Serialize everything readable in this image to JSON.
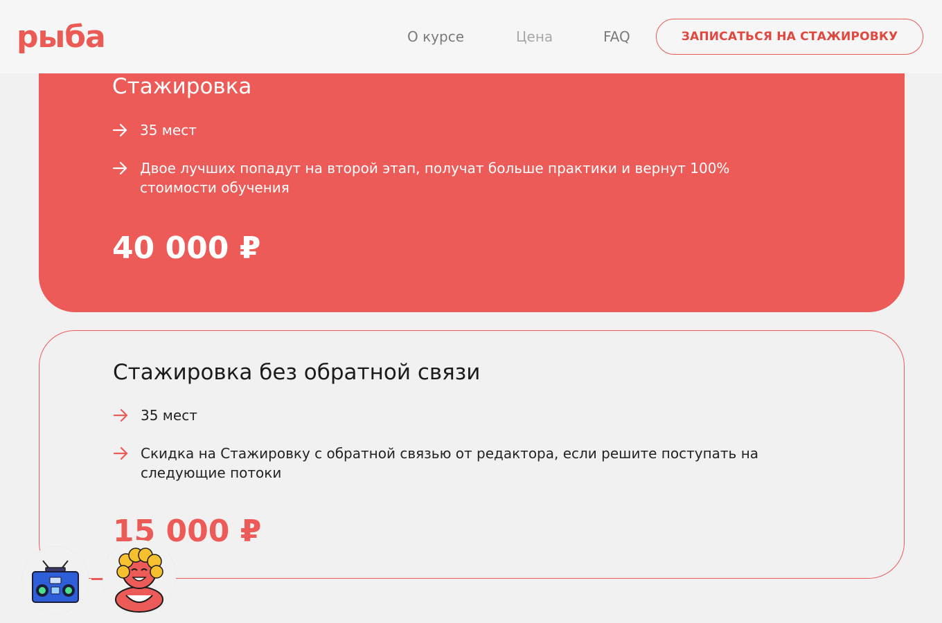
{
  "header": {
    "logo_text": "рыба",
    "nav": {
      "about": "О курсе",
      "price": "Цена",
      "faq": "FAQ"
    },
    "cta_label": "ЗАПИСАТЬСЯ НА СТАЖИРОВКУ"
  },
  "plans": [
    {
      "title": "Стажировка",
      "features": [
        "35 мест",
        "Двое лучших попадут на второй этап, получат больше практики и вернут 100% стоимости обучения"
      ],
      "price": "40 000 ₽"
    },
    {
      "title": "Стажировка без обратной связи",
      "features": [
        "35 мест",
        "Скидка на Стажировку с обратной связью от редактора, если решите поступать на следующие потоки"
      ],
      "price": "15 000 ₽"
    }
  ],
  "widgets": {
    "left_icon": "boombox-icon",
    "right_icon": "mascot-avatar-icon"
  },
  "colors": {
    "accent": "#ec5b57",
    "background": "#f1f1f1",
    "header_bg": "#f6f6f6"
  }
}
